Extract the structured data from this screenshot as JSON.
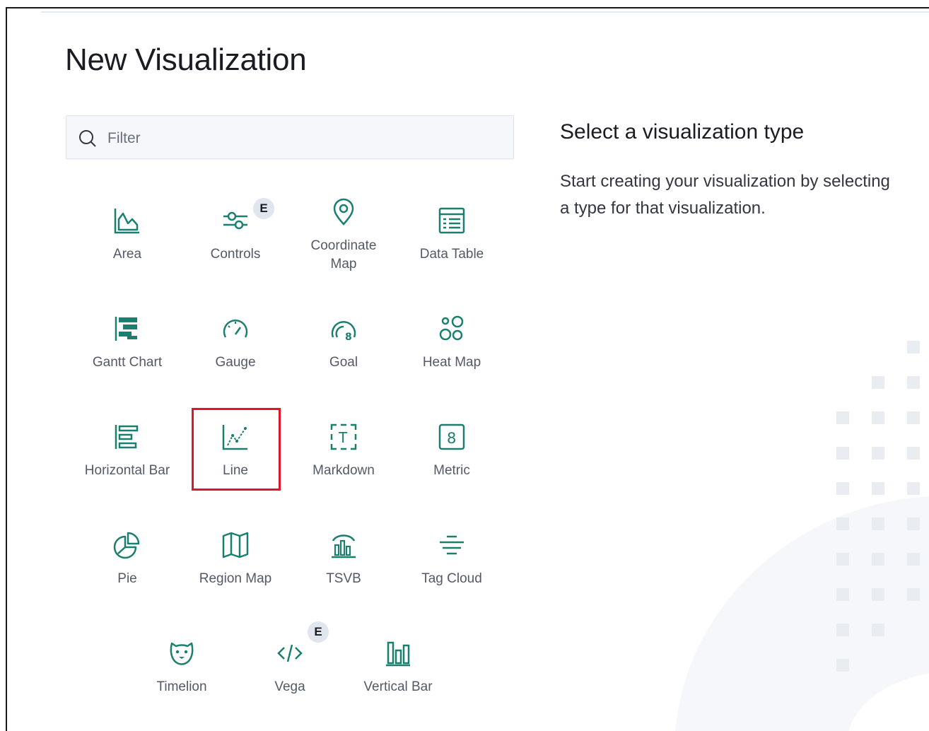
{
  "page": {
    "title": "New Visualization"
  },
  "search": {
    "placeholder": "Filter",
    "value": ""
  },
  "side": {
    "title": "Select a visualization type",
    "description": "Start creating your visualization by selecting a type for that visualization."
  },
  "tiles": [
    {
      "label": "Area",
      "icon": "area-chart-icon"
    },
    {
      "label": "Controls",
      "icon": "controls-icon",
      "badge": "E"
    },
    {
      "label": "Coordinate Map",
      "icon": "map-pin-icon"
    },
    {
      "label": "Data Table",
      "icon": "table-icon"
    },
    {
      "label": "Gantt Chart",
      "icon": "gantt-icon"
    },
    {
      "label": "Gauge",
      "icon": "gauge-icon"
    },
    {
      "label": "Goal",
      "icon": "goal-icon"
    },
    {
      "label": "Heat Map",
      "icon": "heatmap-icon"
    },
    {
      "label": "Horizontal Bar",
      "icon": "horizontal-bar-icon"
    },
    {
      "label": "Line",
      "icon": "line-chart-icon",
      "highlighted": true
    },
    {
      "label": "Markdown",
      "icon": "markdown-icon"
    },
    {
      "label": "Metric",
      "icon": "metric-icon"
    },
    {
      "label": "Pie",
      "icon": "pie-chart-icon"
    },
    {
      "label": "Region Map",
      "icon": "region-map-icon"
    },
    {
      "label": "TSVB",
      "icon": "tsvb-icon"
    },
    {
      "label": "Tag Cloud",
      "icon": "tag-cloud-icon"
    },
    {
      "label": "Timelion",
      "icon": "timelion-icon"
    },
    {
      "label": "Vega",
      "icon": "vega-icon",
      "badge": "E"
    },
    {
      "label": "Vertical Bar",
      "icon": "vertical-bar-icon"
    }
  ],
  "colors": {
    "icon": "#1a7f6e",
    "highlight": "#e0152b",
    "badge_bg": "#e0e5ee"
  }
}
